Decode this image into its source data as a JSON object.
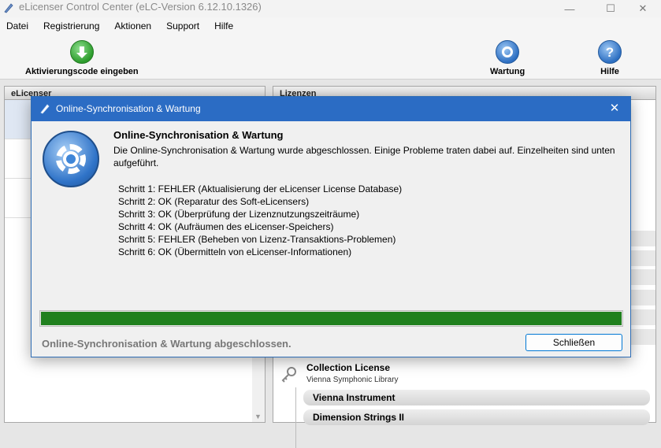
{
  "window": {
    "title": "eLicenser Control Center (eLC-Version 6.12.10.1326)",
    "controls": {
      "minimize": "—",
      "maximize": "☐",
      "close": "✕"
    }
  },
  "menu": [
    "Datei",
    "Registrierung",
    "Aktionen",
    "Support",
    "Hilfe"
  ],
  "toolbar": {
    "activate_label": "Aktivierungscode eingeben",
    "maintenance_label": "Wartung",
    "help_label": "Hilfe",
    "help_glyph": "?"
  },
  "panels": {
    "left_header": "eLicenser",
    "right_header": "Lizenzen"
  },
  "licenses": {
    "title": "Collection License",
    "subtitle": "Vienna Symphonic Library",
    "items": [
      "Vienna Instrument",
      "Dimension Strings II"
    ]
  },
  "dialog": {
    "title": "Online-Synchronisation & Wartung",
    "close_glyph": "✕",
    "heading": "Online-Synchronisation & Wartung",
    "description": "Die Online-Synchronisation & Wartung wurde abgeschlossen. Einige Probleme traten dabei auf. Einzelheiten sind unten aufgeführt.",
    "steps": [
      "Schritt 1: FEHLER  (Aktualisierung der eLicenser License Database)",
      "Schritt 2: OK  (Reparatur des Soft-eLicensers)",
      "Schritt 3: OK  (Überprüfung der Lizenznutzungszeiträume)",
      "Schritt 4: OK  (Aufräumen des eLicenser-Speichers)",
      "Schritt 5: FEHLER  (Beheben von Lizenz-Transaktions-Problemen)",
      "Schritt 6: OK  (Übermitteln von eLicenser-Informationen)"
    ],
    "progress": 1.0,
    "progress_color": "#20801e",
    "status": "Online-Synchronisation & Wartung abgeschlossen.",
    "close_button": "Schließen"
  }
}
